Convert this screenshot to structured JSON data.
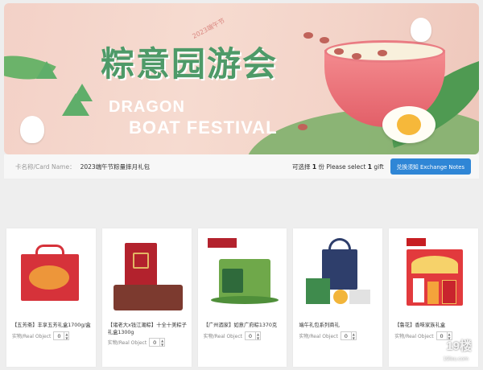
{
  "banner": {
    "title_cn": "粽意园游会",
    "title_en_line1": "DRAGON",
    "title_en_line2": "BOAT FESTIVAL",
    "year_text": "2023端午节"
  },
  "card_info": {
    "label": "卡名称/Card Name：",
    "value": "2023端午节粽量摔月礼包"
  },
  "selection": {
    "prefix": "可选择",
    "count": "1",
    "mid": "份 Please select",
    "count2": "1",
    "suffix": "gift"
  },
  "exchange_button": "兑换须知 Exchange Notes",
  "qty_label": "实物/Real Object",
  "products": [
    {
      "name": "【五芳斋】丰享五芳礼盒1700g/盒",
      "qty": "0"
    },
    {
      "name": "【诸老大x钱江潮粽】十全十美粽子礼盒1300g",
      "qty": "0"
    },
    {
      "name": "【广州酒家】如意广府粽1370克",
      "qty": "0"
    },
    {
      "name": "端午礼包系列商礼",
      "qty": "0"
    },
    {
      "name": "【鲁花】香味家族礼盒",
      "qty": "0"
    }
  ],
  "watermark": {
    "main": "19楼",
    "sub": "19lou.com"
  },
  "colors": {
    "accent": "#2f86d6",
    "banner_green": "#4e9a68"
  }
}
